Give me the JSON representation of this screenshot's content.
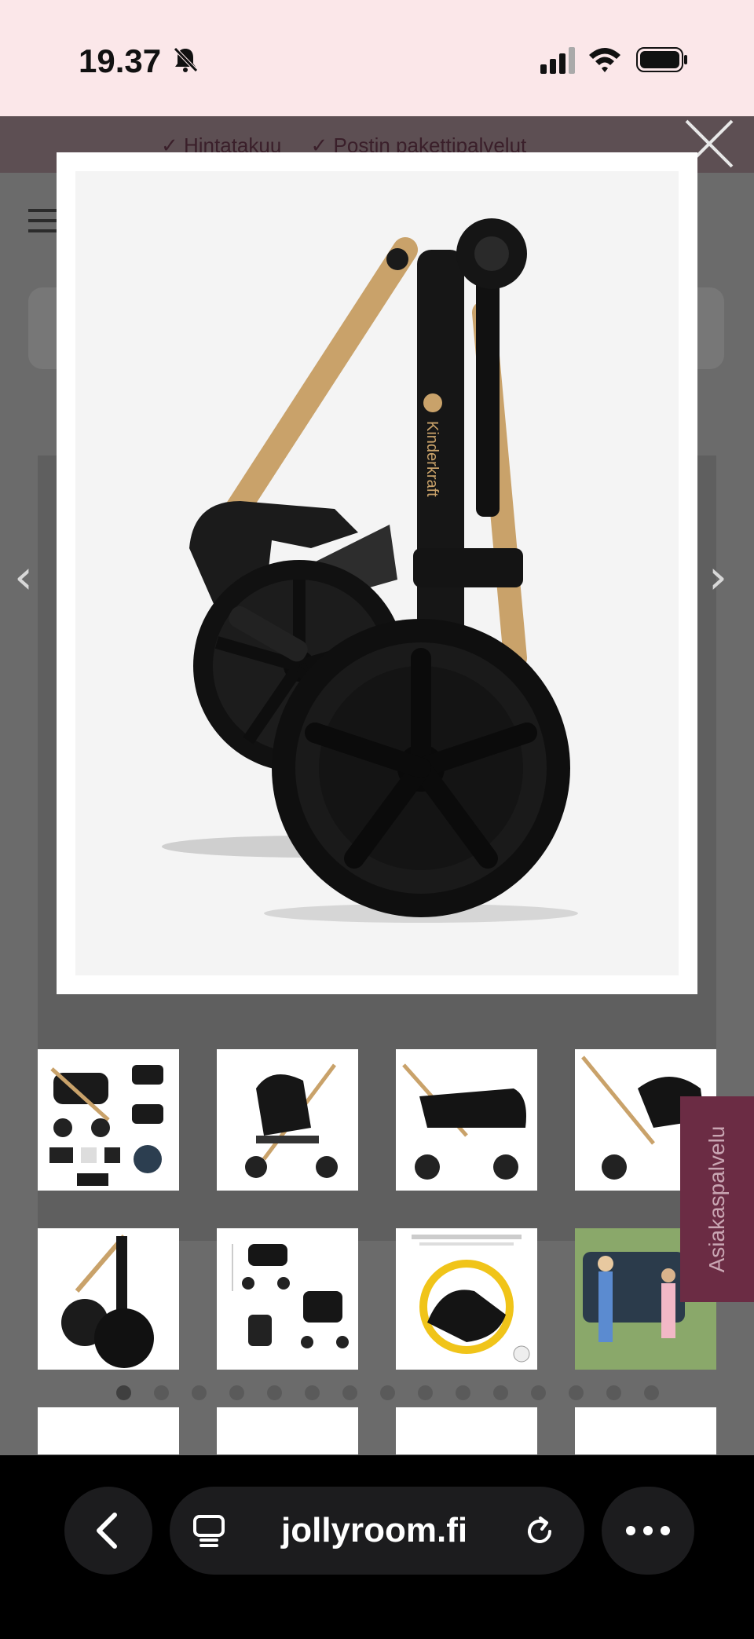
{
  "status_bar": {
    "time": "19.37",
    "icons": [
      "bell-slash-icon",
      "cellular-signal-icon",
      "wifi-icon",
      "battery-icon"
    ]
  },
  "promo_bar": {
    "items": [
      "✓ Hintatakuu",
      "✓ Postin pakettipalvelut"
    ]
  },
  "modal": {
    "image_brand": "Kinderkraft",
    "close_icon": "close-icon",
    "prev_icon": "chevron-left-icon",
    "next_icon": "chevron-right-icon"
  },
  "thumbnails": [
    {
      "name": "stroller-set-overview"
    },
    {
      "name": "stroller-seat-unit"
    },
    {
      "name": "stroller-carrycot"
    },
    {
      "name": "stroller-car-seat"
    },
    {
      "name": "stroller-folded"
    },
    {
      "name": "stroller-dimensions"
    },
    {
      "name": "car-seat-detail"
    },
    {
      "name": "family-car-trunk"
    },
    {
      "name": "thumb-row3-1"
    },
    {
      "name": "thumb-row3-2"
    },
    {
      "name": "thumb-row3-3"
    },
    {
      "name": "thumb-row3-4"
    }
  ],
  "carousel": {
    "dot_count": 15,
    "active_index": 0
  },
  "side_tab": {
    "label": "Asiakaspalvelu"
  },
  "browser": {
    "url": "jollyroom.fi",
    "back_icon": "chevron-left-icon",
    "tabs_icon": "reader-icon",
    "reload_icon": "reload-icon",
    "more_icon": "more-icon"
  },
  "colors": {
    "status_bar_bg": "#fbe7e9",
    "accent_plum": "#6b2c44",
    "frame_gold": "#c9a26a"
  }
}
